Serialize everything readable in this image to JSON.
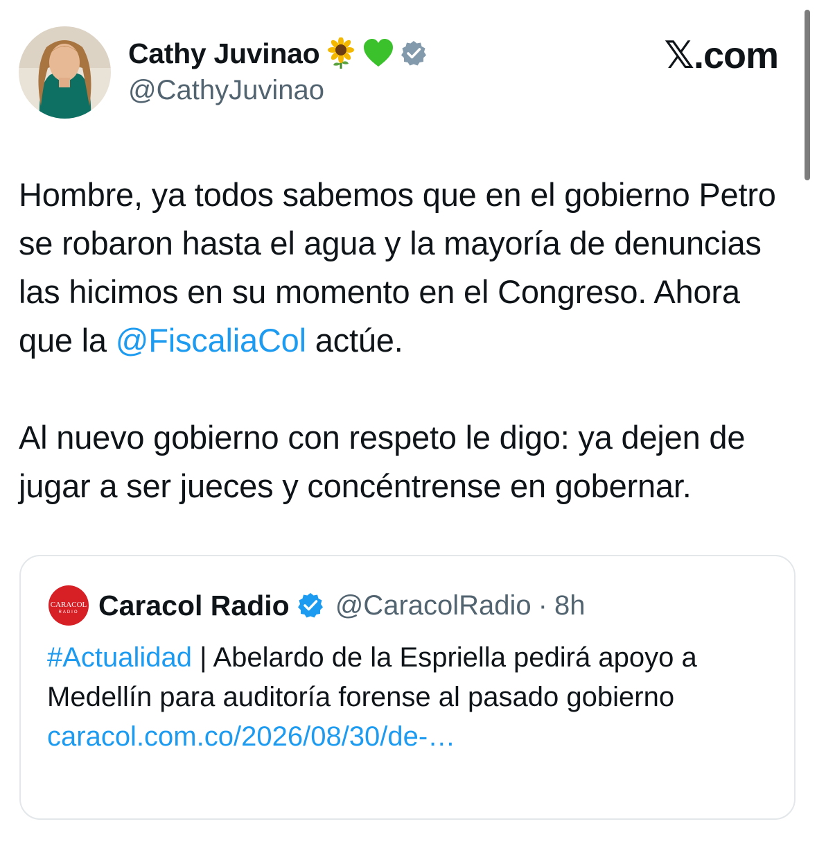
{
  "author": {
    "display_name": "Cathy Juvinao",
    "emojis": [
      "sunflower-icon",
      "green-heart-icon"
    ],
    "handle": "@CathyJuvinao",
    "verified_badge_color": "#829aab"
  },
  "site_logo": "𝕏.com",
  "tweet": {
    "paragraph1_before": "Hombre, ya todos sabemos que en el gobierno Petro se robaron hasta el agua y la mayoría de denuncias las hicimos en su momento en el Congreso. Ahora que la ",
    "mention": "@FiscaliaCol",
    "paragraph1_after": " actúe.",
    "paragraph2": "Al nuevo gobierno con respeto le digo: ya dejen de jugar a ser jueces y concéntrense en gobernar."
  },
  "quoted": {
    "name": "Caracol Radio",
    "handle": "@CaracolRadio",
    "separator": "·",
    "time": "8h",
    "hashtag": "#Actualidad",
    "text": " | Abelardo de la Espriella pedirá apoyo a Medellín para auditoría forense al pasado gobierno",
    "link": "caracol.com.co/2026/08/30/de-…",
    "logo_text_top": "CARACOL",
    "logo_text_bottom": "RADIO",
    "verified_badge_color": "#1d9bf0"
  },
  "colors": {
    "link": "#1d9bf0",
    "secondary_text": "#536471",
    "primary_text": "#0f1419"
  }
}
